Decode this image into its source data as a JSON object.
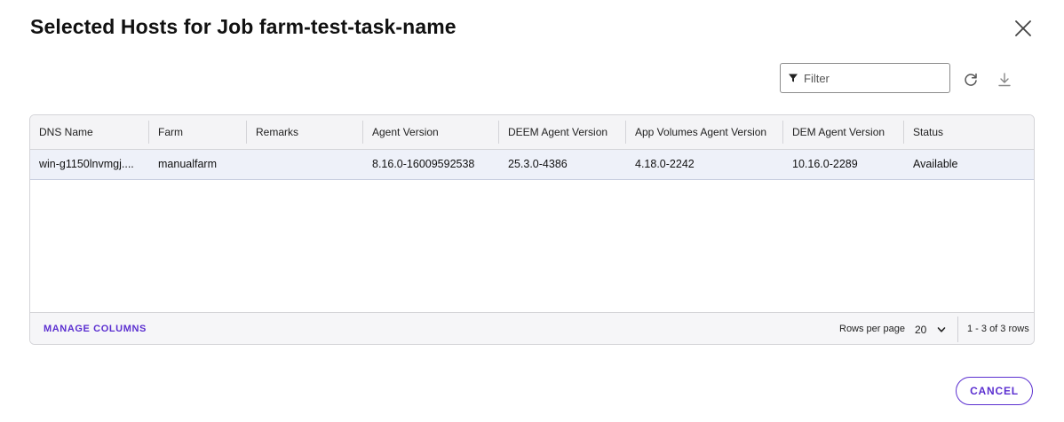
{
  "dialog": {
    "title": "Selected Hosts for Job farm-test-task-name",
    "cancel_label": "CANCEL"
  },
  "icons": {
    "close": "close-icon",
    "filter": "filter-icon",
    "refresh": "refresh-icon",
    "download": "download-icon",
    "chevron": "chevron-down-icon"
  },
  "toolbar": {
    "filter_placeholder": "Filter",
    "filter_value": ""
  },
  "table": {
    "columns": [
      "DNS Name",
      "Farm",
      "Remarks",
      "Agent Version",
      "DEEM Agent Version",
      "App Volumes Agent Version",
      "DEM Agent Version",
      "Status"
    ],
    "rows": [
      [
        "win-g1150lnvmgj....",
        "manualfarm",
        "",
        "8.16.0-16009592538",
        "25.3.0-4386",
        "4.18.0-2242",
        "10.16.0-2289",
        "Available"
      ]
    ]
  },
  "footer": {
    "manage_columns": "MANAGE COLUMNS",
    "rows_per_page_label": "Rows per page",
    "rows_per_page_value": "20",
    "page_info": "1 - 3 of 3 rows"
  },
  "colors": {
    "accent": "#5b2fd0",
    "selected_row": "#eef1f9",
    "header_bg": "#f4f4f6"
  }
}
